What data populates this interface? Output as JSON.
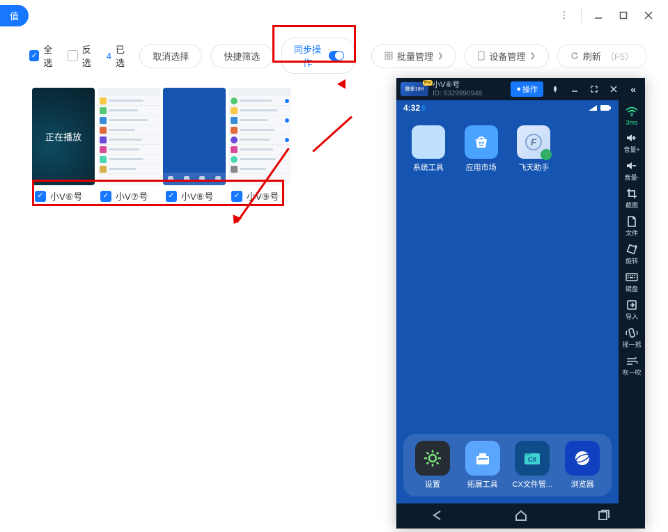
{
  "header": {
    "recharge": "值"
  },
  "toolbar": {
    "select_all": "全选",
    "invert": "反选",
    "selected_count": "4",
    "selected_label": "已选",
    "cancel": "取消选择",
    "filter": "快捷筛选",
    "sync": "同步操作",
    "batch": "批量管理",
    "device_mgr": "设备管理",
    "refresh": "刷新",
    "refresh_key": "（F5）"
  },
  "devices": [
    {
      "label": "小V⑥号",
      "playing": "正在播放"
    },
    {
      "label": "小V⑦号"
    },
    {
      "label": "小V⑧号"
    },
    {
      "label": "小V⑨号"
    }
  ],
  "phone": {
    "logo_text": "微多10H",
    "logo_tag": "Pro",
    "title": "小V⑥号",
    "id_label": "ID: 8329990948",
    "operate": "操作",
    "status_time": "4:32",
    "apps": {
      "sys_tools": "系统工具",
      "app_market": "应用市场",
      "ft_helper": "飞天助手",
      "settings": "设置",
      "ext_tools": "拓展工具",
      "cx_files": "CX文件管...",
      "browser": "浏览器"
    },
    "rail": {
      "latency": "3ms",
      "vol_up": "音量+",
      "vol_dn": "音量-",
      "screenshot": "截图",
      "file": "文件",
      "rotate": "旋转",
      "keyboard": "键盘",
      "import": "导入",
      "shake": "摇一摇",
      "blow": "吹一吹"
    }
  }
}
